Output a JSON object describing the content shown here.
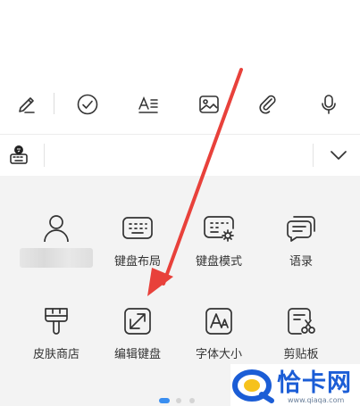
{
  "panel": {
    "row1": [
      {
        "label": "",
        "icon": "user-icon"
      },
      {
        "label": "键盘布局",
        "icon": "keyboard-icon"
      },
      {
        "label": "键盘模式",
        "icon": "keyboard-settings-icon"
      },
      {
        "label": "语录",
        "icon": "quotes-icon"
      }
    ],
    "row2": [
      {
        "label": "皮肤商店",
        "icon": "skin-brush-icon"
      },
      {
        "label": "编辑键盘",
        "icon": "edit-keyboard-icon"
      },
      {
        "label": "字体大小",
        "icon": "font-size-icon"
      },
      {
        "label": "剪贴板",
        "icon": "clipboard-icon"
      }
    ]
  },
  "toolbar": {
    "icons": [
      "pen-icon",
      "check-circle-icon",
      "text-format-icon",
      "image-icon",
      "attachment-icon",
      "microphone-icon"
    ]
  },
  "candidate_bar": {
    "left_icon": "keyboard-globe-icon",
    "right_icon": "chevron-down-icon"
  },
  "watermark": {
    "text": "恰卡网",
    "url": "www.qiaqa.com"
  },
  "colors": {
    "panel_bg": "#f3f3f3",
    "accent": "#3a8ef0",
    "arrow": "#e8413b"
  }
}
